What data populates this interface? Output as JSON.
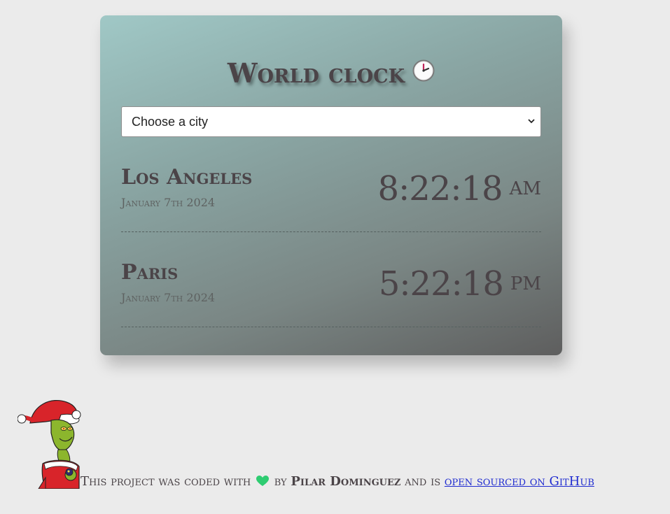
{
  "app": {
    "title": "World clock",
    "title_icon": "clock-icon"
  },
  "city_select": {
    "selected": "Choose a city"
  },
  "cities": [
    {
      "name": "Los Angeles",
      "date": "January 7th 2024",
      "time": "8:22:18",
      "ampm": "AM"
    },
    {
      "name": "Paris",
      "date": "January 7th 2024",
      "time": "5:22:18",
      "ampm": "PM"
    }
  ],
  "footer": {
    "prefix": "This project was coded with",
    "heart_icon": "green-heart-icon",
    "by": "by",
    "author": "Pilar Dominguez",
    "middle": "and is",
    "link_text": "open sourced on GitHub",
    "avatar": "grinch-santa-image"
  },
  "colors": {
    "background": "#ebebeb",
    "card_gradient_start": "#a0c8c6",
    "card_gradient_end": "#5e5e5e",
    "text": "#4b4448",
    "link": "#1f2bd0",
    "heart": "#2ecc71"
  }
}
